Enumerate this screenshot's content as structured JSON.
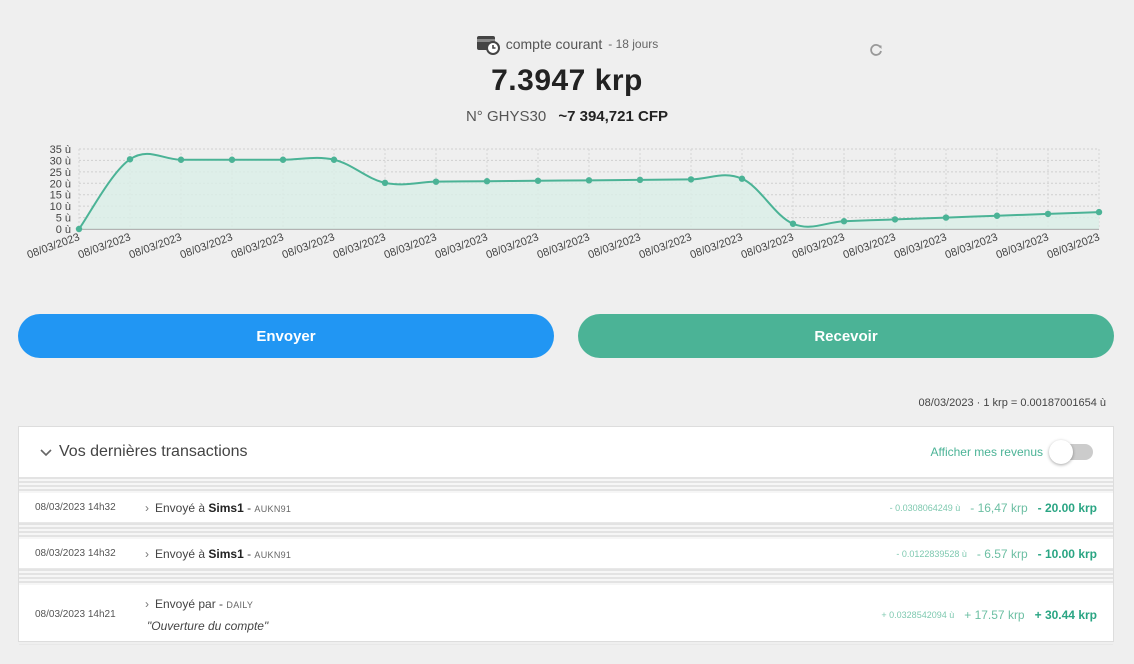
{
  "account": {
    "name": "compte courant",
    "days": "- 18 jours",
    "balance": "7.3947 krp",
    "number": "N° GHYS30",
    "fiat": "~7 394,721 CFP"
  },
  "chart_data": {
    "type": "area",
    "x": [
      "08/03/2023",
      "08/03/2023",
      "08/03/2023",
      "08/03/2023",
      "08/03/2023",
      "08/03/2023",
      "08/03/2023",
      "08/03/2023",
      "08/03/2023",
      "08/03/2023",
      "08/03/2023",
      "08/03/2023",
      "08/03/2023",
      "08/03/2023",
      "08/03/2023",
      "08/03/2023",
      "08/03/2023",
      "08/03/2023",
      "08/03/2023",
      "08/03/2023",
      "08/03/2023"
    ],
    "values": [
      0,
      30.5,
      30.3,
      30.3,
      30.3,
      30.3,
      20.2,
      20.7,
      20.9,
      21.1,
      21.3,
      21.5,
      21.7,
      22.0,
      2.3,
      3.4,
      4.2,
      5.0,
      5.8,
      6.6,
      7.4
    ],
    "yticks": [
      "35 ù",
      "30 ù",
      "25 ù",
      "20 ù",
      "15 ù",
      "10 ù",
      "5 ù",
      "0 ù"
    ],
    "ylim": [
      0,
      35
    ],
    "grid": true,
    "colors": {
      "line": "#4bb396",
      "fill": "#d9efe7"
    }
  },
  "buttons": {
    "send": "Envoyer",
    "receive": "Recevoir"
  },
  "rate": "08/03/2023 · 1 krp = 0.00187001654 ù",
  "transactions": {
    "title": "Vos dernières transactions",
    "toggle_label": "Afficher mes revenus",
    "toggle_on": false,
    "rows": [
      {
        "date": "08/03/2023 14h32",
        "prefix": "Envoyé à",
        "who": "Sims1",
        "sep": " - ",
        "code": "AUKN91",
        "small": "- 0.0308064249 ù",
        "mid": "- 16,47 krp",
        "big": "- 20.00 krp"
      },
      {
        "date": "08/03/2023 14h32",
        "prefix": "Envoyé à",
        "who": "Sims1",
        "sep": " - ",
        "code": "AUKN91",
        "small": "- 0.0122839528 ù",
        "mid": "- 6.57 krp",
        "big": "- 10.00 krp"
      },
      {
        "date": "08/03/2023 14h21",
        "prefix": "Envoyé par -",
        "who": "",
        "sep": " ",
        "code": "DAILY",
        "note": "\"Ouverture du compte\"",
        "small": "+ 0.0328542094 ù",
        "mid": "+ 17.57 krp",
        "big": "+ 30.44 krp"
      }
    ]
  }
}
